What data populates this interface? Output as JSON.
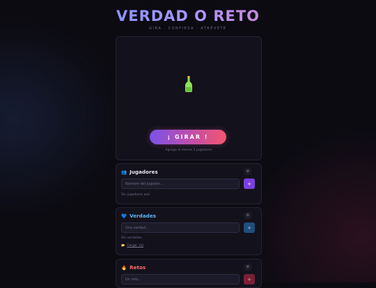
{
  "header": {
    "title": "VERDAD O RETO",
    "subtitle": "GIRA · CONFIESA · ATRÉVETE"
  },
  "stage": {
    "spin_label": "¡ GIRAR !",
    "hint": "Agrega al menos 2 jugadores"
  },
  "players": {
    "emoji": "👥",
    "title": "Jugadores",
    "toggle": "⚙",
    "placeholder": "Nombre del jugador...",
    "add": "+",
    "empty": "Sin jugadores aún"
  },
  "truths": {
    "emoji": "💙",
    "title": "Verdades",
    "toggle": "⚙",
    "placeholder": "Una verdad...",
    "add": "+",
    "empty": "Sin verdades",
    "load_icon": "📂",
    "load_label": "Cargar .txt"
  },
  "dares": {
    "emoji": "🔥",
    "title": "Retos",
    "toggle": "⚙",
    "placeholder": "Un reto...",
    "add": "+"
  },
  "colors": {
    "players_add": "#7b3fe0",
    "truths_add": "#1f4e7a",
    "truths_title": "#5ab8f0",
    "dares_title": "#ff6b6b",
    "dares_add": "#7a1f36"
  }
}
